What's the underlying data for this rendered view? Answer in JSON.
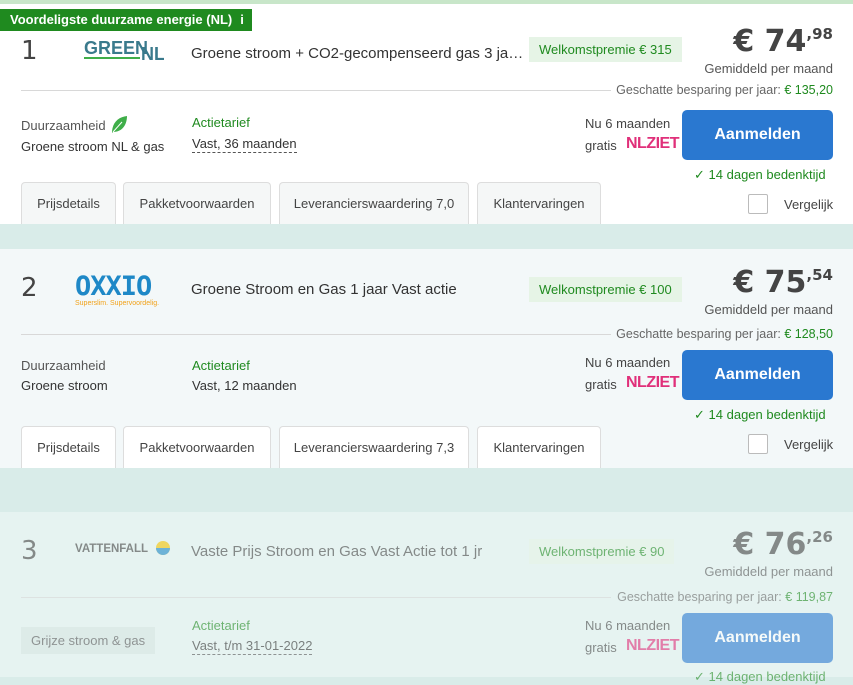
{
  "badge": {
    "label": "Voordeligste duurzame energie (NL)",
    "info": "i"
  },
  "tabs": [
    "Prijsdetails",
    "Pakketvoorwaarden",
    "Klantervaringen"
  ],
  "common": {
    "duurzaamheid": "Duurzaamheid",
    "actietarief": "Actietarief",
    "gemiddeld": "Gemiddeld per maand",
    "besparing_label": "Geschatte besparing per jaar:",
    "nu": "Nu 6 maanden",
    "gratis": "gratis",
    "nlziet": "NLZIET",
    "aanmelden": "Aanmelden",
    "bedenktijd": "14 dagen bedenktijd",
    "vergelijk": "Vergelijk"
  },
  "offers": [
    {
      "rank": "1",
      "logo": "GREEN NL",
      "title": "Groene stroom + CO2-gecompenseerd gas 3 ja…",
      "premie": "Welkomstpremie € 315",
      "price_main": "€ 74",
      "price_cents": ",98",
      "besparing": "€ 135,20",
      "stroom": "Groene stroom NL & gas",
      "contract": "Vast, 36 maanden",
      "waardering": "Leverancierswaardering 7,0"
    },
    {
      "rank": "2",
      "logo": "OXXIO",
      "logo_tagline": "Superslim. Supervoordelig.",
      "title": "Groene Stroom en Gas 1 jaar Vast actie",
      "premie": "Welkomstpremie € 100",
      "price_main": "€ 75",
      "price_cents": ",54",
      "besparing": "€ 128,50",
      "stroom": "Groene stroom",
      "contract": "Vast, 12 maanden",
      "waardering": "Leverancierswaardering 7,3"
    },
    {
      "rank": "3",
      "logo": "VATTENFALL",
      "title": "Vaste Prijs Stroom en Gas Vast Actie tot 1 jr",
      "premie": "Welkomstpremie € 90",
      "price_main": "€ 76",
      "price_cents": ",26",
      "besparing": "€ 119,87",
      "stroom": "Grijze stroom & gas",
      "contract": "Vast, t/m 31-01-2022"
    }
  ],
  "colors": {
    "accent_green": "#1f8a1f",
    "button_blue": "#2a78d0",
    "nlziet_pink": "#e0307a"
  }
}
